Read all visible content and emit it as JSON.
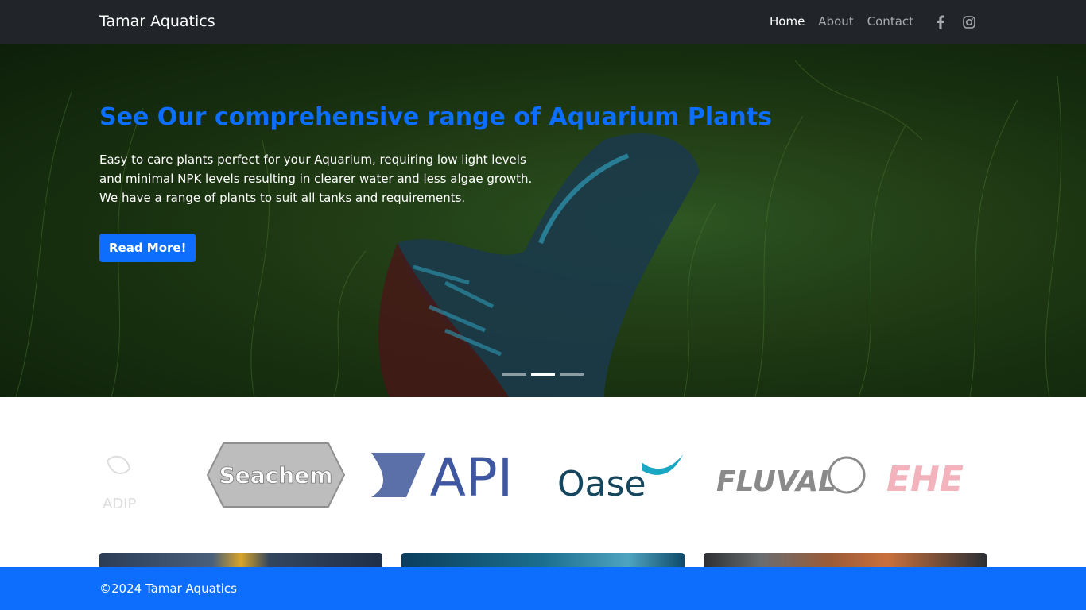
{
  "nav": {
    "brand": "Tamar Aquatics",
    "links": [
      "Home",
      "About",
      "Contact"
    ],
    "active": "Home",
    "social_icons": [
      "facebook-icon",
      "instagram-icon"
    ]
  },
  "hero": {
    "title": "See Our comprehensive range of Aquarium Plants",
    "body": "Easy to care plants perfect for your Aquarium, requiring low light levels and minimal NPK levels resulting in clearer water and less algae growth. We have a range of plants to suit all tanks and requirements.",
    "button": "Read More!",
    "slide_count": 3,
    "active_slide": 2
  },
  "brand_logos": [
    "ADIP",
    "Seachem",
    "API",
    "Oase",
    "FLUVAL",
    "EHE"
  ],
  "footer": {
    "text": "©2024 Tamar Aquatics"
  },
  "colors": {
    "primary": "#0d6efd",
    "navbar": "#212529"
  }
}
